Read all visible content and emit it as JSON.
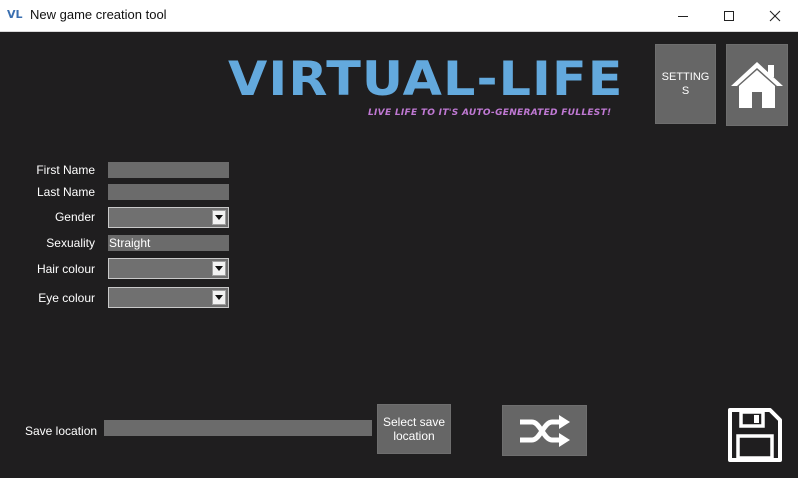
{
  "window": {
    "title": "New game creation tool",
    "app_icon_text": "VL",
    "controls": {
      "minimize": "minimize-icon",
      "maximize": "maximize-icon",
      "close": "close-icon"
    }
  },
  "header": {
    "logo_title": "VIRTUAL-LIFE",
    "logo_subtitle": "LIVE LIFE TO IT'S AUTO-GENERATED FULLEST!",
    "logo_title_color": "#63a9dd",
    "logo_subtitle_color": "#c079d4",
    "settings_label": "SETTINGS",
    "home_icon": "home-icon"
  },
  "form": {
    "first_name": {
      "label": "First Name",
      "value": ""
    },
    "last_name": {
      "label": "Last Name",
      "value": ""
    },
    "gender": {
      "label": "Gender",
      "value": ""
    },
    "sexuality": {
      "label": "Sexuality",
      "value": "Straight"
    },
    "hair_colour": {
      "label": "Hair colour",
      "value": ""
    },
    "eye_colour": {
      "label": "Eye colour",
      "value": ""
    }
  },
  "footer": {
    "save_location_label": "Save location",
    "save_location_value": "",
    "select_save_location_label": "Select save location",
    "shuffle_icon": "shuffle-icon",
    "save_icon": "floppy-disk-icon"
  },
  "colors": {
    "background": "#1f1e1f",
    "tile": "#666666",
    "field": "#6b6b6b"
  }
}
